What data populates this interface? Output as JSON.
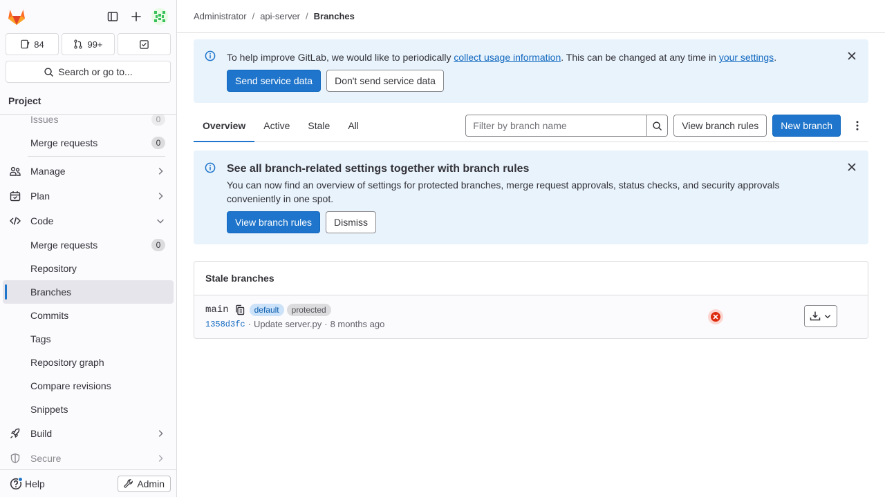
{
  "sidebar": {
    "counts": {
      "issues": "84",
      "merge_requests": "99+"
    },
    "search_label": "Search or go to...",
    "project_header": "Project",
    "nav": {
      "issues_partial": "Issues",
      "merge_requests_top": "Merge requests",
      "merge_requests_top_count": "0",
      "manage": "Manage",
      "plan": "Plan",
      "code": "Code",
      "code_items": [
        {
          "label": "Merge requests",
          "count": "0"
        },
        {
          "label": "Repository"
        },
        {
          "label": "Branches"
        },
        {
          "label": "Commits"
        },
        {
          "label": "Tags"
        },
        {
          "label": "Repository graph"
        },
        {
          "label": "Compare revisions"
        },
        {
          "label": "Snippets"
        }
      ],
      "build": "Build",
      "secure": "Secure"
    },
    "help": "Help",
    "admin": "Admin"
  },
  "breadcrumb": {
    "items": [
      "Administrator",
      "api-server"
    ],
    "current": "Branches"
  },
  "usage_alert": {
    "text_before": "To help improve GitLab, we would like to periodically ",
    "link1": "collect usage information",
    "text_middle": ". This can be changed at any time in ",
    "link2": "your settings",
    "text_after": ".",
    "send_button": "Send service data",
    "dont_send_button": "Don't send service data"
  },
  "tabs": [
    "Overview",
    "Active",
    "Stale",
    "All"
  ],
  "filter": {
    "placeholder": "Filter by branch name"
  },
  "toolbar": {
    "view_rules": "View branch rules",
    "new_branch": "New branch"
  },
  "rules_alert": {
    "title": "See all branch-related settings together with branch rules",
    "body": "You can now find an overview of settings for protected branches, merge request approvals, status checks, and security approvals conveniently in one spot.",
    "view_button": "View branch rules",
    "dismiss_button": "Dismiss"
  },
  "stale_card": {
    "title": "Stale branches",
    "branches": [
      {
        "name": "main",
        "labels": [
          "default",
          "protected"
        ],
        "sha": "1358d3fc",
        "message": "Update server.py",
        "time": "8 months ago",
        "pipeline_status": "failed"
      }
    ]
  },
  "colors": {
    "accent": "#1f75cb",
    "alert_bg": "#e9f3fc",
    "failed": "#dd2b0e"
  }
}
